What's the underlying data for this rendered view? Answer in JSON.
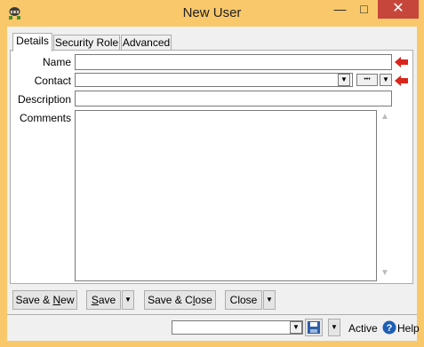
{
  "window": {
    "title": "New User"
  },
  "titlebar": {
    "minimize_glyph": "—",
    "maximize_glyph": "□",
    "close_glyph": "✕"
  },
  "tabs": [
    {
      "label": "Details",
      "active": true
    },
    {
      "label": "Security Role",
      "active": false
    },
    {
      "label": "Advanced",
      "active": false
    }
  ],
  "form": {
    "name_label": "Name",
    "name_value": "",
    "contact_label": "Contact",
    "contact_value": "",
    "contact_more_glyph": "•••",
    "description_label": "Description",
    "description_value": "",
    "comments_label": "Comments",
    "comments_value": ""
  },
  "buttons": {
    "save_new_pre": "Save & ",
    "save_new_ul": "N",
    "save_new_post": "ew",
    "save_ul": "S",
    "save_post": "ave",
    "save_close_pre": "Save & C",
    "save_close_ul": "l",
    "save_close_post": "ose",
    "close_label": "Close"
  },
  "status": {
    "dropdown_value": "",
    "active_label": "Active",
    "help_label": "Help"
  },
  "icons": {
    "app": "user-ninja-icon",
    "required": "red-arrow-icon",
    "save_disk": "floppy-disk-icon",
    "help": "help-circle-icon"
  },
  "colors": {
    "frame": "#f8c86a",
    "close_button": "#c7463c",
    "required_arrow": "#d9261c",
    "help_icon": "#1e5fb4"
  }
}
